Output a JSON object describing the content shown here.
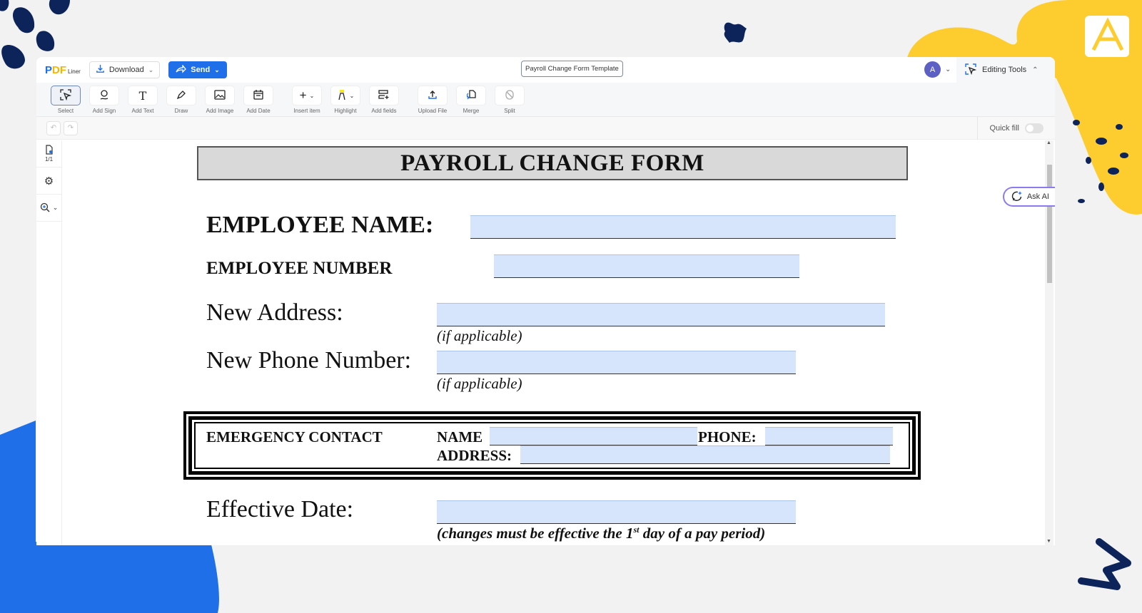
{
  "app": {
    "logo": {
      "p": "P",
      "d": "D",
      "f": "F",
      "liner": "Liner"
    },
    "download_label": "Download",
    "send_label": "Send",
    "document_title": "Payroll Change Form Template",
    "avatar_initial": "A",
    "editing_tools_label": "Editing Tools"
  },
  "toolbar": {
    "tools": [
      {
        "label": "Select",
        "icon": "select-icon"
      },
      {
        "label": "Add Sign",
        "icon": "signature-icon"
      },
      {
        "label": "Add Text",
        "icon": "text-icon"
      },
      {
        "label": "Draw",
        "icon": "pen-icon"
      },
      {
        "label": "Add Image",
        "icon": "image-icon"
      },
      {
        "label": "Add Date",
        "icon": "calendar-icon"
      },
      {
        "label": "Insert item",
        "icon": "plus-icon"
      },
      {
        "label": "Highlight",
        "icon": "highlighter-icon"
      },
      {
        "label": "Add fields",
        "icon": "add-fields-icon"
      },
      {
        "label": "Upload File",
        "icon": "upload-icon"
      },
      {
        "label": "Merge",
        "icon": "merge-icon"
      },
      {
        "label": "Split",
        "icon": "split-icon"
      }
    ]
  },
  "subbar": {
    "quick_fill_label": "Quick fill",
    "quick_fill_on": false
  },
  "leftbar": {
    "page_counter": "1/1"
  },
  "ask_ai_label": "Ask AI",
  "form": {
    "title": "PAYROLL CHANGE FORM",
    "employee_name_label": "EMPLOYEE NAME:",
    "employee_number_label": "EMPLOYEE NUMBER",
    "new_address_label": "New Address:",
    "new_address_hint": "(if applicable)",
    "new_phone_label": "New Phone Number:",
    "new_phone_hint": "(if applicable)",
    "emergency_contact_label": "EMERGENCY CONTACT",
    "ec_name_label": "NAME",
    "ec_phone_label": "PHONE:",
    "ec_address_label": "ADDRESS:",
    "effective_date_label": "Effective Date:",
    "effective_hint_pre": "(changes must be effective the 1",
    "effective_hint_sup": "st",
    "effective_hint_post": " day of a pay period)",
    "fields": {
      "employee_name": "",
      "employee_number": "",
      "new_address": "",
      "new_phone": "",
      "ec_name": "",
      "ec_phone": "",
      "ec_address": "",
      "effective_date": ""
    }
  },
  "colors": {
    "brand_blue": "#1e6fe8",
    "brand_yellow": "#fdcd2f",
    "field_fill": "#d6e5fb",
    "avatar": "#5c5fc4"
  }
}
